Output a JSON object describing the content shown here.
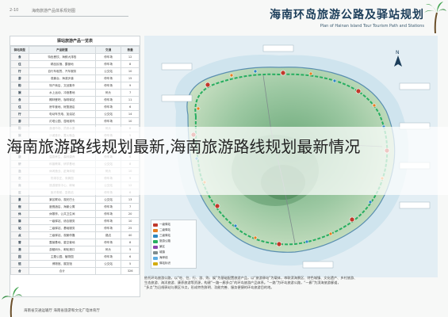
{
  "header": {
    "code": "2-10",
    "caption": "海南旅游产品体系规划图"
  },
  "title": {
    "cn": "海南环岛旅游公路及驿站规划",
    "en": "Plan of Hainan Island Tour Tourism Path and Stations"
  },
  "table": {
    "title": "驿站旅游产品一览表",
    "headers": [
      "驿站类型",
      "产品配置",
      "交通",
      "数量"
    ],
    "rows": [
      {
        "cat": "食",
        "a": "特色餐饮、海鲜大排档",
        "b": "停车场",
        "c": "12"
      },
      {
        "cat": "住",
        "a": "精品民宿、露营地",
        "b": "停车场",
        "c": "8"
      },
      {
        "cat": "行",
        "a": "自行车租赁、汽车服务",
        "b": "公交站",
        "c": "10"
      },
      {
        "cat": "游",
        "a": "观景台、海滨步道",
        "b": "停车场",
        "c": "15"
      },
      {
        "cat": "购",
        "a": "特产商店、文创集市",
        "b": "停车场",
        "c": "9"
      },
      {
        "cat": "娱",
        "a": "水上运动、冲浪基地",
        "b": "码头",
        "c": "7"
      },
      {
        "cat": "食",
        "a": "椰林餐吧、咖啡驿站",
        "b": "停车场",
        "c": "11"
      },
      {
        "cat": "住",
        "a": "房车营地、帐篷酒店",
        "b": "停车场",
        "c": "6"
      },
      {
        "cat": "行",
        "a": "电动车充电、加油站",
        "b": "公交站",
        "c": "14"
      },
      {
        "cat": "游",
        "a": "灯塔公园、湿地观鸟",
        "b": "停车场",
        "c": "10"
      },
      {
        "cat": "购",
        "a": "渔港市场、热带水果",
        "b": "码头",
        "c": "8"
      },
      {
        "cat": "娱",
        "a": "沙滩音乐、篝火晚会",
        "b": "停车场",
        "c": "5"
      },
      {
        "cat": "体",
        "a": "骑行驿站、健身步道",
        "b": "停车场",
        "c": "9"
      },
      {
        "cat": "文",
        "a": "黎苗文化、非遗展示",
        "b": "公交站",
        "c": "7"
      },
      {
        "cat": "康",
        "a": "温泉养生、森林康养",
        "b": "停车场",
        "c": "6"
      },
      {
        "cat": "研",
        "a": "科普教育、研学基地",
        "b": "公交站",
        "c": "8"
      },
      {
        "cat": "渔",
        "a": "休闲渔业、赶海体验",
        "b": "码头",
        "c": "10"
      },
      {
        "cat": "农",
        "a": "热带农庄、采摘园",
        "b": "停车场",
        "c": "9"
      },
      {
        "cat": "商",
        "a": "旅游服务中心、邮局",
        "b": "公交站",
        "c": "12"
      },
      {
        "cat": "医",
        "a": "医疗救助、急救站",
        "b": "停车场",
        "c": "6"
      },
      {
        "cat": "景",
        "a": "景区联动、观光巴士",
        "b": "公交站",
        "c": "13"
      },
      {
        "cat": "宿",
        "a": "度假酒店、海景公寓",
        "b": "停车场",
        "c": "7"
      },
      {
        "cat": "休",
        "a": "休憩亭、公共卫生间",
        "b": "停车场",
        "c": "20"
      },
      {
        "cat": "驿",
        "a": "一级驿站、综合服务",
        "b": "停车场",
        "c": "10"
      },
      {
        "cat": "站",
        "a": "二级驿站、基础服务",
        "b": "停车场",
        "c": "25"
      },
      {
        "cat": "点",
        "a": "三级驿站、观景停靠",
        "b": "路边",
        "c": "40"
      },
      {
        "cat": "营",
        "a": "露营基地、星空营地",
        "b": "停车场",
        "c": "8"
      },
      {
        "cat": "港",
        "a": "游艇码头、邮轮港口",
        "b": "码头",
        "c": "5"
      },
      {
        "cat": "园",
        "a": "主题公园、植物园",
        "b": "停车场",
        "c": "6"
      },
      {
        "cat": "馆",
        "a": "博物馆、展览馆",
        "b": "公交站",
        "c": "5"
      },
      {
        "cat": "合",
        "a": "合计",
        "b": "",
        "c": "326"
      }
    ]
  },
  "legend": {
    "items": [
      {
        "label": "一级驿站",
        "color": "#c0392b"
      },
      {
        "label": "二级驿站",
        "color": "#e67e22"
      },
      {
        "label": "三级驿站",
        "color": "#2e86c1"
      },
      {
        "label": "旅游公路",
        "color": "#27ae60"
      },
      {
        "label": "景区",
        "color": "#8e44ad"
      },
      {
        "label": "城镇",
        "color": "#7f8c8d"
      },
      {
        "label": "海岸线",
        "color": "#5dade2"
      },
      {
        "label": "驿站标识",
        "color": "#d4ac0d"
      }
    ]
  },
  "notes": [
    "依托环岛旅游公路，以“吃、住、行、游、购、娱”为基础配置旅游产品，以“旅游驿站”为载体，串联滨海景区、特色城镇、文化遗产、乡村旅游、",
    "生态旅游、海洋旅游、康养旅游等资源，构建“一路一廊多点”的环岛旅游产品体系。“一路”为环岛旅游公路，“一廊”为滨海旅游廊道，",
    "“多点”为沿线驿站与景区节点，形成特色鲜明、功能完善、服务便捷的环岛旅游目的地。"
  ],
  "footer": "海南省交通运输厅  海南省旅游和文化广电体育厅",
  "overlay": {
    "text": "海南旅游路线规划最新,海南旅游路线规划最新情况"
  },
  "colors": {
    "sea": "#e3eef4",
    "land": "#9cc8a2",
    "road": "#27ae60",
    "title": "#1b3d5a"
  }
}
